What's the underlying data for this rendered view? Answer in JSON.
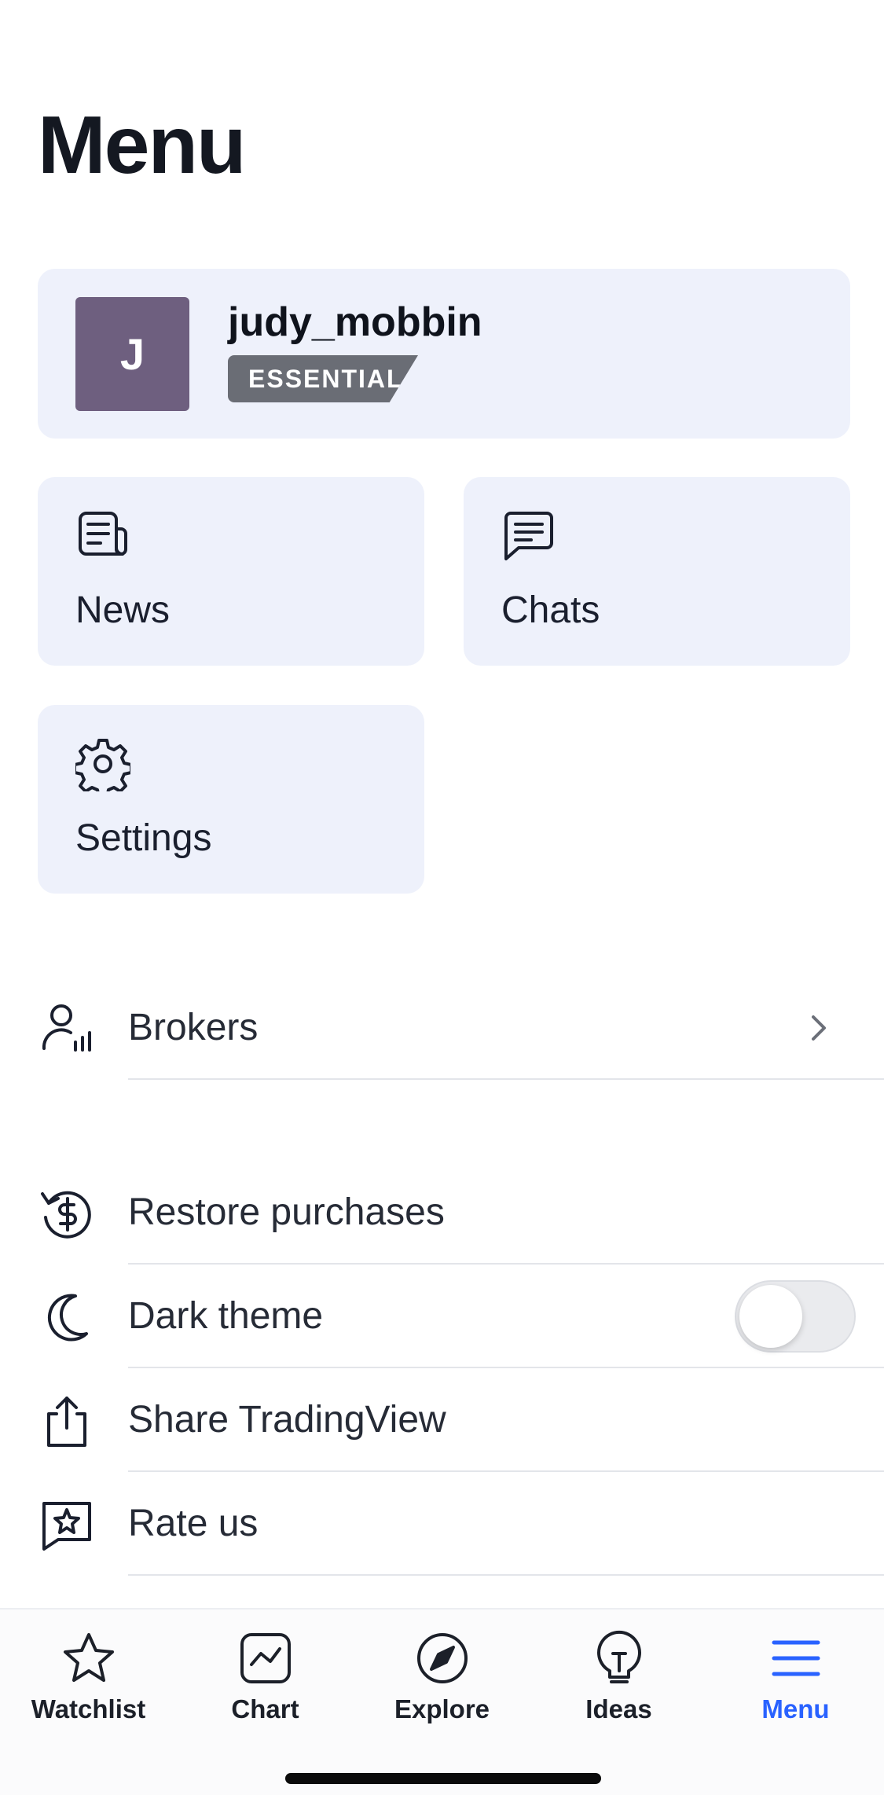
{
  "page": {
    "title": "Menu"
  },
  "profile": {
    "avatar_letter": "J",
    "username": "judy_mobbin",
    "plan": "ESSENTIAL",
    "avatar_color": "#6e5f7f"
  },
  "tiles": [
    {
      "label": "News",
      "icon": "news-icon"
    },
    {
      "label": "Chats",
      "icon": "chat-icon"
    },
    {
      "label": "Settings",
      "icon": "gear-icon"
    }
  ],
  "rows": {
    "brokers": {
      "label": "Brokers",
      "icon": "broker-icon"
    },
    "restore": {
      "label": "Restore purchases",
      "icon": "restore-dollar-icon"
    },
    "dark_theme": {
      "label": "Dark theme",
      "icon": "moon-icon",
      "enabled": false
    },
    "share": {
      "label": "Share TradingView",
      "icon": "share-icon"
    },
    "rate": {
      "label": "Rate us",
      "icon": "star-message-icon"
    }
  },
  "tabbar": {
    "active": "Menu",
    "accent_color": "#2962ff",
    "tabs": [
      {
        "label": "Watchlist",
        "icon": "star-icon"
      },
      {
        "label": "Chart",
        "icon": "chart-icon"
      },
      {
        "label": "Explore",
        "icon": "compass-icon"
      },
      {
        "label": "Ideas",
        "icon": "lightbulb-icon"
      },
      {
        "label": "Menu",
        "icon": "hamburger-icon"
      }
    ]
  }
}
